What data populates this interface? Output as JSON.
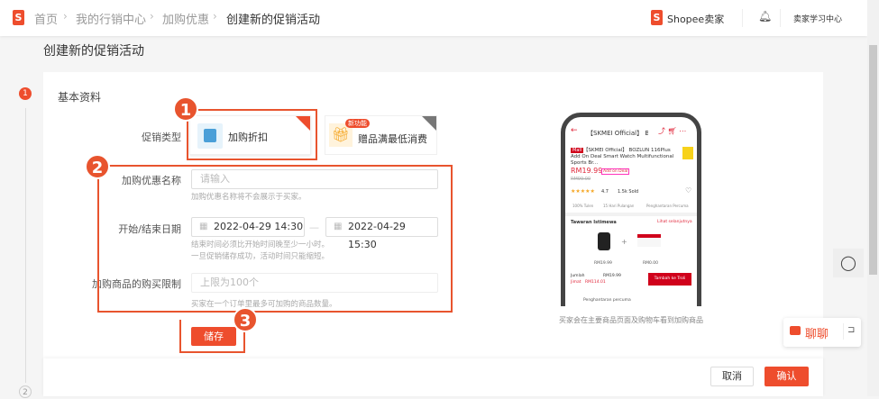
{
  "header": {
    "breadcrumb": [
      "首页",
      "我的行销中心",
      "加购优惠",
      "创建新的促销活动"
    ],
    "brand": "Shopee卖家",
    "learn": "卖家学习中心",
    "logo_letter": "S"
  },
  "page_title": "创建新的促销活动",
  "steps": [
    "1",
    "2"
  ],
  "section_title": "基本资料",
  "form": {
    "type_label": "促销类型",
    "type_options": [
      {
        "label": "加购折扣",
        "selected": true
      },
      {
        "label": "赠品满最低消费",
        "badge": "新功能",
        "selected": false
      }
    ],
    "name_label": "加购优惠名称",
    "name_placeholder": "请输入",
    "name_hint": "加购优惠名称将不会展示于买家。",
    "date_label": "开始/结束日期",
    "start": "2022-04-29 14:30",
    "end": "2022-04-29 15:30",
    "date_sep": "—",
    "date_hint1": "结束时间必须比开始时间晚至少一小时。",
    "date_hint2": "一旦促销储存成功，活动时间只能缩短。",
    "limit_label": "加购商品的购买限制",
    "limit_placeholder": "上限为100个",
    "limit_hint": "买家在一个订单里最多可加购的商品数量。",
    "save": "储存"
  },
  "annotations": [
    "1",
    "2",
    "3"
  ],
  "preview": {
    "caption": "买家会在主要商品页面及购物车看到加购商品",
    "title": "【SKMEI Official】 B...",
    "tag": "Mall",
    "product": "【SKMEI Official】 BOZLUN 116Plus Add On Deal Smart Watch Multifunctional Sports Br...",
    "price": "RM19.99",
    "deal": "Add on Deal",
    "old_price": "RM99.00",
    "rating": "4.7",
    "sold": "1.5k Sold",
    "features": [
      "100% Tulen",
      "15 Hari Pulangan",
      "Penghantaran Percuma"
    ],
    "offers_title": "Tawaran Istimewa",
    "see_more": "Lihat selanjutnya",
    "item_prices": [
      "RM19.99",
      "RM0.00"
    ],
    "total_label": "Jumlah",
    "total": "RM19.99",
    "save_label": "Jimat",
    "save_amount": "RM114.01",
    "add_cart": "Tambah ke Troli",
    "shipping": "Penghantaran percuma"
  },
  "footer": {
    "cancel": "取消",
    "confirm": "确认"
  },
  "chat": {
    "label": "聊聊"
  },
  "colors": {
    "accent": "#ee4d2d",
    "annotation": "#e8542e"
  }
}
